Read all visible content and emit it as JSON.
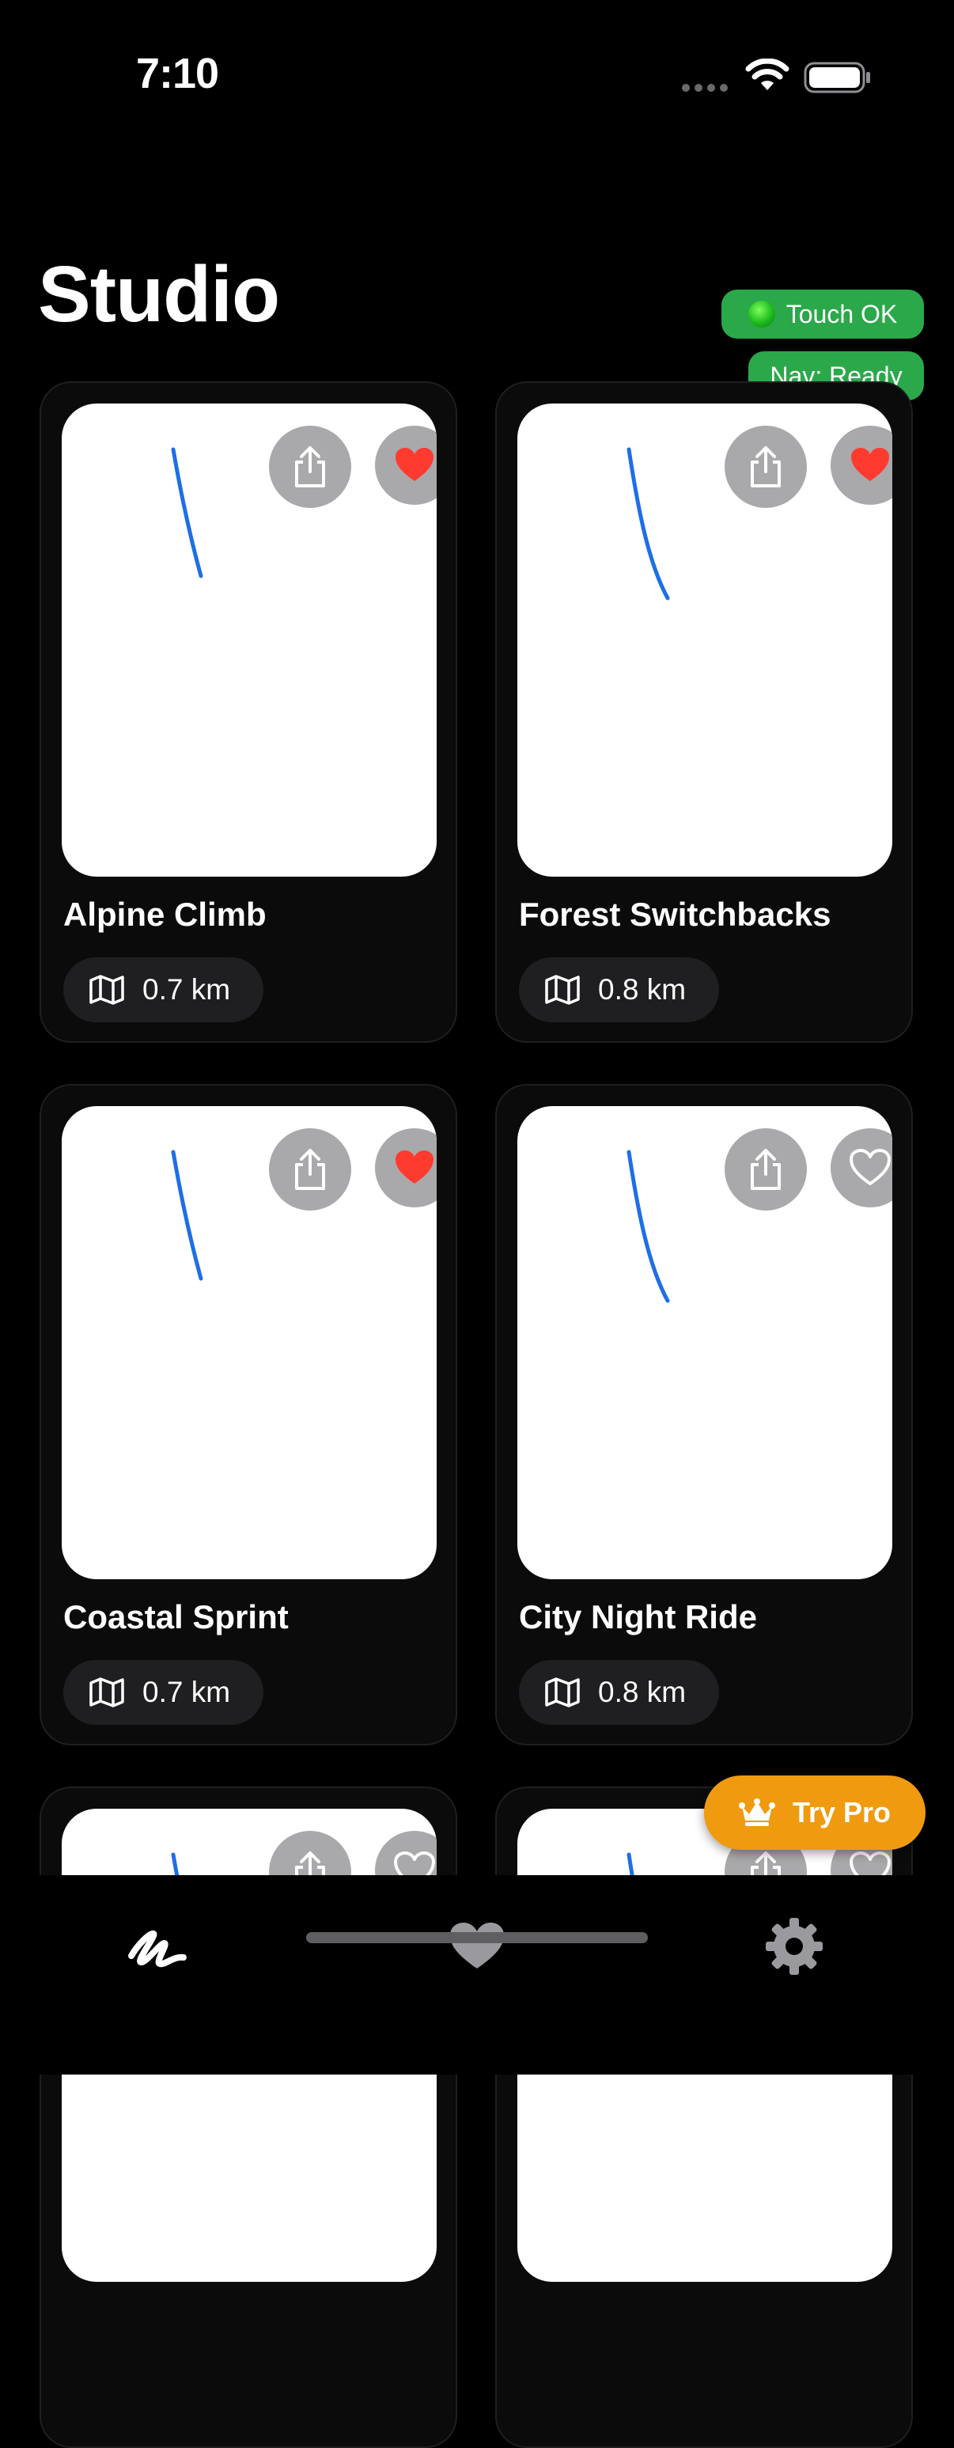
{
  "status": {
    "time": "7:10"
  },
  "page": {
    "title": "Studio"
  },
  "debug": {
    "touch_label": "Touch OK",
    "nav_label": "Nav: Ready"
  },
  "routes": [
    {
      "title": "Alpine Climb",
      "distance": "0.7 km",
      "favorited": true
    },
    {
      "title": "Forest Switchbacks",
      "distance": "0.8 km",
      "favorited": true
    },
    {
      "title": "Coastal Sprint",
      "distance": "0.7 km",
      "favorited": true
    },
    {
      "title": "City Night Ride",
      "distance": "0.8 km",
      "favorited": false
    },
    {
      "favorited": false
    },
    {
      "favorited": false
    }
  ],
  "promo": {
    "label": "Try Pro"
  },
  "tabs": {
    "draw": "draw-icon",
    "favorites": "heart-icon",
    "settings": "gear-icon"
  },
  "colors": {
    "route": "#1e6fe6",
    "favorite": "#ff3b30",
    "pill_green": "#2ba84a",
    "promo": "#f09a0f"
  }
}
